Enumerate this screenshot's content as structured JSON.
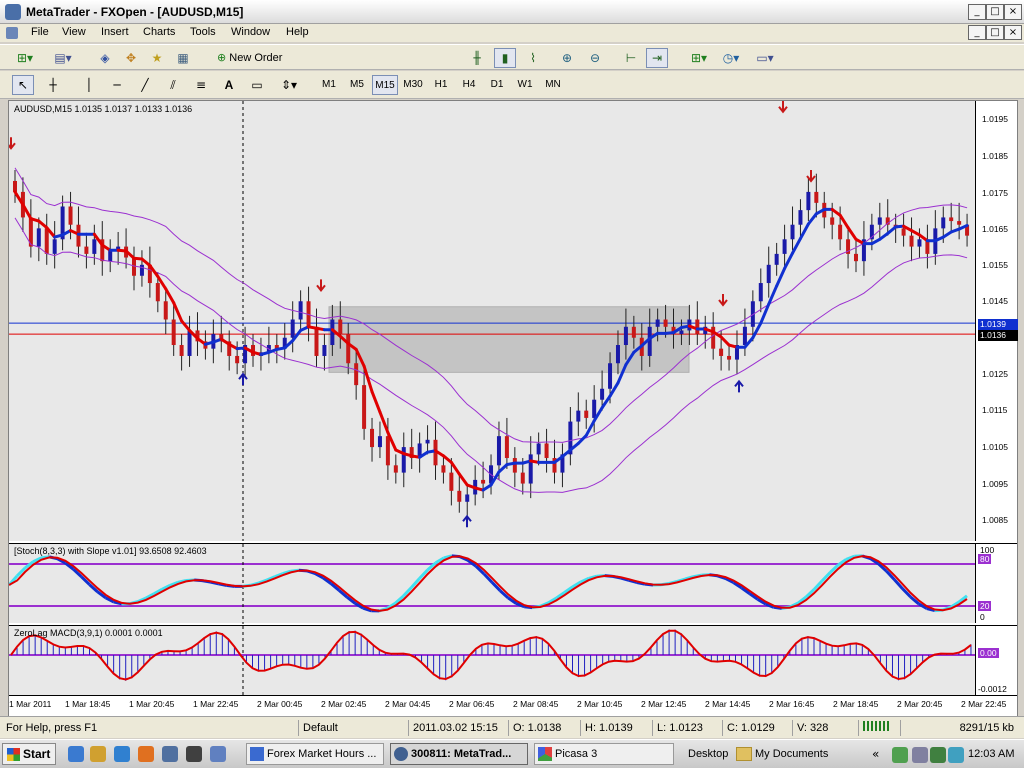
{
  "window": {
    "title": "MetaTrader - FXOpen - [AUDUSD,M15]",
    "minimize": "_",
    "restore": "□",
    "close": "×"
  },
  "menu": [
    "File",
    "View",
    "Insert",
    "Charts",
    "Tools",
    "Window",
    "Help"
  ],
  "toolbar1": {
    "new_order": "New Order"
  },
  "toolbar2": {
    "label_tool": "A",
    "timeframes": [
      "M1",
      "M5",
      "M15",
      "M30",
      "H1",
      "H4",
      "D1",
      "W1",
      "MN"
    ],
    "active_timeframe": "M15"
  },
  "chart": {
    "header": "AUDUSD,M15  1.0135 1.0137 1.0133 1.0136",
    "price_labels": [
      "1.0195",
      "1.0185",
      "1.0175",
      "1.0165",
      "1.0155",
      "1.0145",
      "1.0125",
      "1.0115",
      "1.0105",
      "1.0095",
      "1.0085"
    ],
    "blue_line_price": "1.0139",
    "red_line_price": "1.0136",
    "time_labels": [
      "1 Mar 2011",
      "1 Mar 18:45",
      "1 Mar 20:45",
      "1 Mar 22:45",
      "2 Mar 00:45",
      "2 Mar 02:45",
      "2 Mar 04:45",
      "2 Mar 06:45",
      "2 Mar 08:45",
      "2 Mar 10:45",
      "2 Mar 12:45",
      "2 Mar 14:45",
      "2 Mar 16:45",
      "2 Mar 18:45",
      "2 Mar 20:45",
      "2 Mar 22:45"
    ],
    "colors": {
      "bull": "#1a1aa8",
      "bear": "#c81818",
      "ma_red": "#e00000",
      "ma_blue": "#1030d0",
      "band": "#9b30d0",
      "cyan": "#40e0f0"
    }
  },
  "stoch": {
    "header": "[Stoch(8,3,3) with Slope v1.01] 93.6508 92.4603",
    "levels": [
      "100",
      "80",
      "20",
      "0"
    ]
  },
  "macd": {
    "header": "ZeroLag MACD(3,9,1) 0.0001 0.0001",
    "levels": [
      "0.00",
      "-0.0012"
    ]
  },
  "status": {
    "help": "For Help, press F1",
    "profile": "Default",
    "datetime": "2011.03.02 15:15",
    "open": "O: 1.0138",
    "high": "H: 1.0139",
    "low": "L: 1.0123",
    "close": "C: 1.0129",
    "volume": "V: 328",
    "traffic": "8291/15 kb"
  },
  "taskbar": {
    "start": "Start",
    "tasks": [
      "Forex Market Hours ...",
      "300811: MetaTrad...",
      "Picasa 3"
    ],
    "desktop": "Desktop",
    "my_documents": "My Documents",
    "clock": "12:03 AM"
  }
}
